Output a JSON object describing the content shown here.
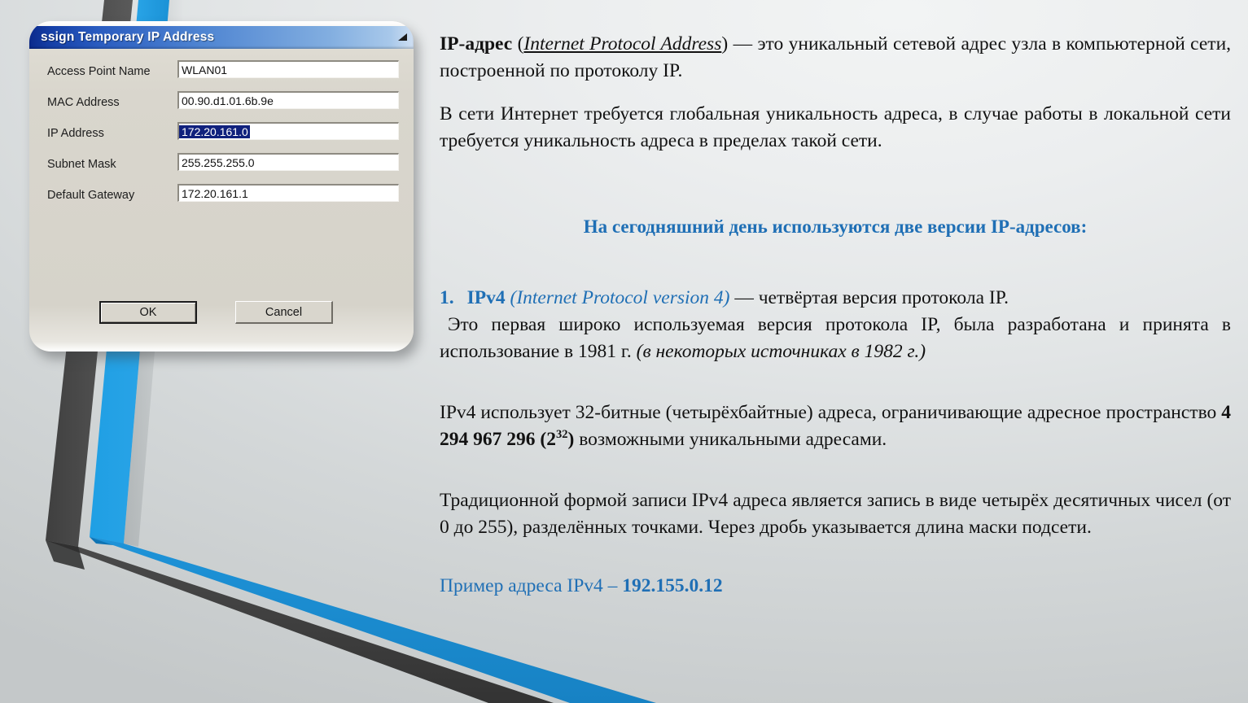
{
  "slide": {
    "background_top": "#eceeef",
    "background_bottom": "#c4c8c9",
    "accent_blue": "#1f9ae0",
    "accent_dark": "#4a4a4a",
    "text_blue": "#1f6fb5"
  },
  "dialog": {
    "title": "ssign Temporary IP Address",
    "titlebar_color": "#1540a8",
    "fields": [
      {
        "label": "Access Point Name",
        "value": "WLAN01",
        "selected": false
      },
      {
        "label": "MAC Address",
        "value": "00.90.d1.01.6b.9e",
        "selected": false
      },
      {
        "label": "IP Address",
        "value": "172.20.161.0",
        "selected": true
      },
      {
        "label": "Subnet Mask",
        "value": "255.255.255.0",
        "selected": false
      },
      {
        "label": "Default Gateway",
        "value": "172.20.161.1",
        "selected": false
      }
    ],
    "ok_label": "OK",
    "cancel_label": "Cancel"
  },
  "content": {
    "para1": {
      "term": "IP-адрес",
      "space1": "  ",
      "open_paren": "(",
      "english": "Internet  Protocol  Address",
      "close_paren": ")",
      "rest": " — это уникальный сетевой адрес узла в компьютерной сети, построенной по протоколу IP."
    },
    "para2": "В сети Интернет требуется глобальная уникальность адреса, в случае работы в локальной сети требуется уникальность адреса в пределах такой сети.",
    "heading": "На сегодняшний день используются две версии IP-адресов:",
    "item1": {
      "number": "1.",
      "name": "IPv4",
      "expansion": "(Internet Protocol version 4)",
      "tail": " — четвёртая версия протокола IP."
    },
    "para3_a": " Это первая широко используемая версия протокола IP,   была разработана и принята в использование в 1981 г. ",
    "para3_b": "(в некоторых источниках в 1982 г.)",
    "para4_a": "IPv4 использует 32-битные (четырёхбайтные) адреса, ограничивающие адресное пространство ",
    "para4_num": "4 294 967 296 (2",
    "para4_sup": "32",
    "para4_close": ")",
    "para4_b": " возможными уникальными адресами.",
    "para5": "Традиционной формой записи IPv4 адреса является запись в виде четырёх десятичных чисел (от 0 до 255), разделённых точками. Через дробь указывается длина маски подсети.",
    "example_label": "Пример адреса IPv4 – ",
    "example_addr": "192.155.0.12"
  }
}
